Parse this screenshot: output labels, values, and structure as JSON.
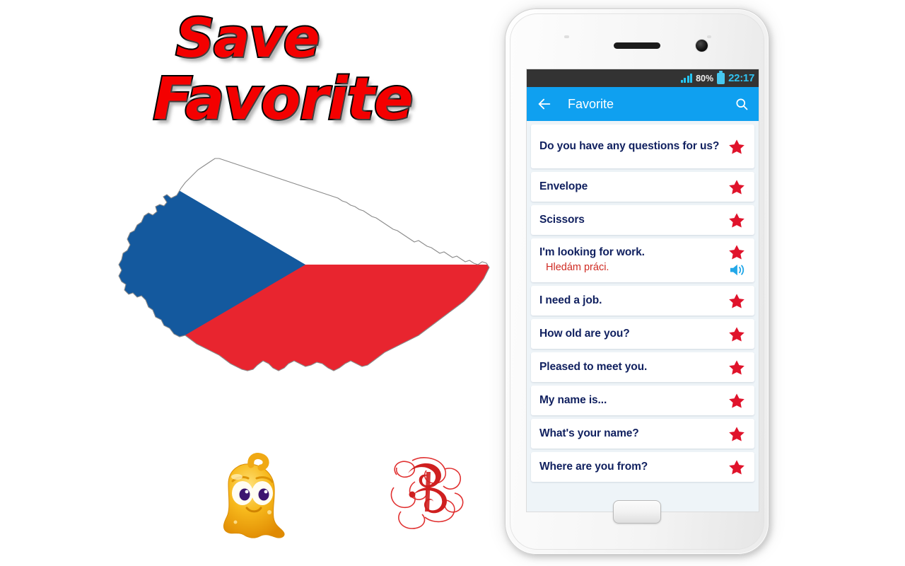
{
  "promo": {
    "line1": "Save",
    "line2": "Favorite",
    "color": "#f40000",
    "outline": "#000000"
  },
  "map": {
    "name": "czech-republic-flag-map",
    "blue": "#14599e",
    "red": "#e8252f",
    "white": "#ffffff",
    "outline": "#8a8a8a"
  },
  "decorations": {
    "mascot": {
      "name": "golden-slime-mascot",
      "color": "#f5a623"
    },
    "ornament": {
      "name": "calligraphic-letter-ornament",
      "color": "#d32020"
    }
  },
  "phone": {
    "statusbar": {
      "signal_icon": "signal-bars-icon",
      "battery_percent": "80%",
      "battery_icon": "battery-icon",
      "clock": "22:17",
      "background": "#333333",
      "accent": "#2fc3f2"
    },
    "appbar": {
      "back_icon": "back-arrow-icon",
      "title": "Favorite",
      "search_icon": "search-icon",
      "background": "#0fa0f0"
    },
    "home_button": "home-button"
  },
  "list": {
    "star_icon": "star-icon",
    "speaker_icon": "speaker-icon",
    "star_color": "#e0132b",
    "items": [
      {
        "en": "Do you have any questions for us?",
        "cz": "",
        "starred": true,
        "speaker": false
      },
      {
        "en": "Envelope",
        "cz": "",
        "starred": true,
        "speaker": false
      },
      {
        "en": "Scissors",
        "cz": "",
        "starred": true,
        "speaker": false
      },
      {
        "en": "I'm looking for work.",
        "cz": "Hledám práci.",
        "starred": true,
        "speaker": true
      },
      {
        "en": "I need a job.",
        "cz": "",
        "starred": true,
        "speaker": false
      },
      {
        "en": "How old are you?",
        "cz": "",
        "starred": true,
        "speaker": false
      },
      {
        "en": "Pleased to meet you.",
        "cz": "",
        "starred": true,
        "speaker": false
      },
      {
        "en": "My name is...",
        "cz": "",
        "starred": true,
        "speaker": false
      },
      {
        "en": "What's your name?",
        "cz": "",
        "starred": true,
        "speaker": false
      },
      {
        "en": "Where are you from?",
        "cz": "",
        "starred": true,
        "speaker": false
      }
    ]
  }
}
